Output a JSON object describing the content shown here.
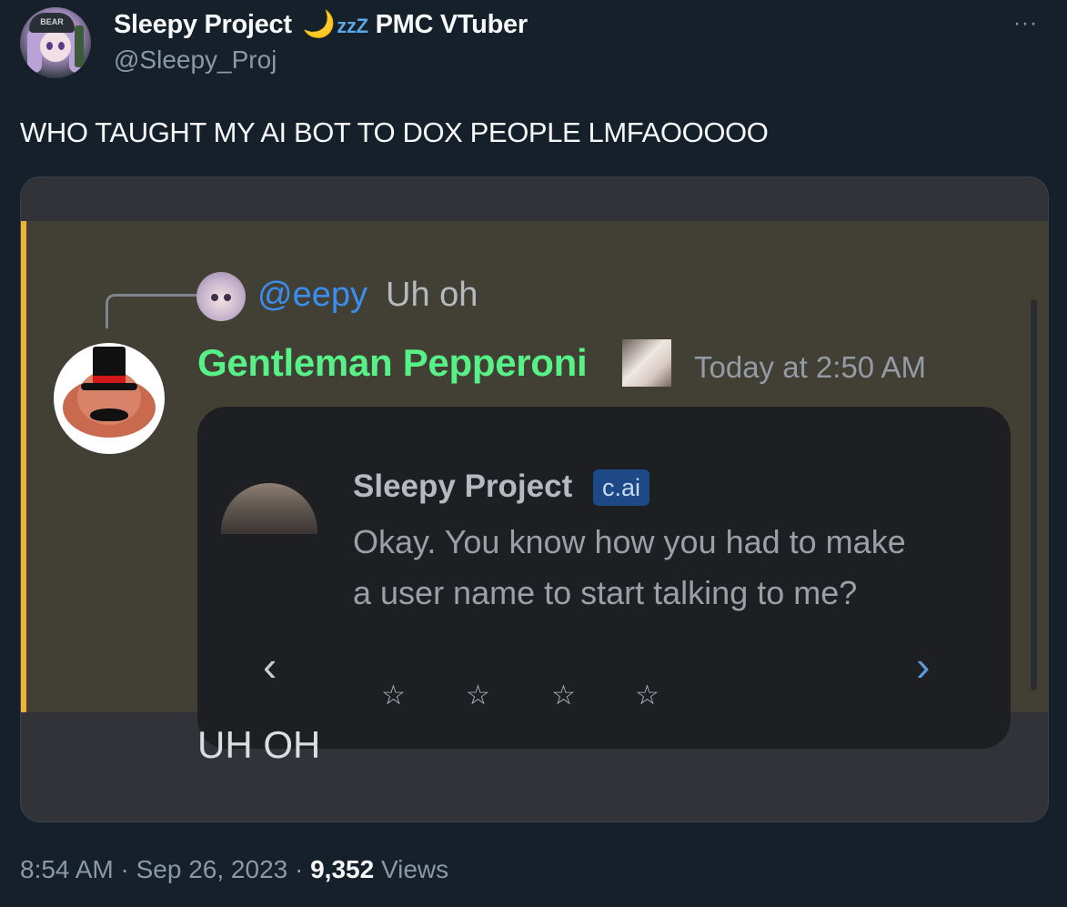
{
  "tweet": {
    "author": {
      "display_name": "Sleepy Project",
      "moon_emoji": "🌙",
      "zzz": "zzZ",
      "tag": "PMC VTuber",
      "handle": "@Sleepy_Proj",
      "avatar_cap_text": "BEAR"
    },
    "more_icon": "···",
    "text": "WHO TAUGHT MY AI BOT TO DOX PEOPLE LMFAOOOOO",
    "footer": {
      "time": "8:54 AM",
      "separator": " · ",
      "date": "Sep 26, 2023",
      "views_count": "9,352",
      "views_label": "Views"
    }
  },
  "discord": {
    "reply": {
      "mention": "@eepy",
      "text": "Uh oh"
    },
    "message": {
      "author": "Gentleman Pepperoni",
      "timestamp": "Today at 2:50 AM",
      "name_color": "#57f287"
    },
    "embed": {
      "author": "Sleepy Project",
      "badge": "c.ai",
      "line1": "Okay. You know how you had to make",
      "line2": "a user name to start talking to me?",
      "prev_icon": "‹",
      "next_icon": "›",
      "stars": [
        "☆",
        "☆",
        "☆",
        "☆"
      ]
    },
    "followup": "UH OH",
    "accent_color": "#f0b232",
    "mention_color": "#3b8ef0"
  }
}
